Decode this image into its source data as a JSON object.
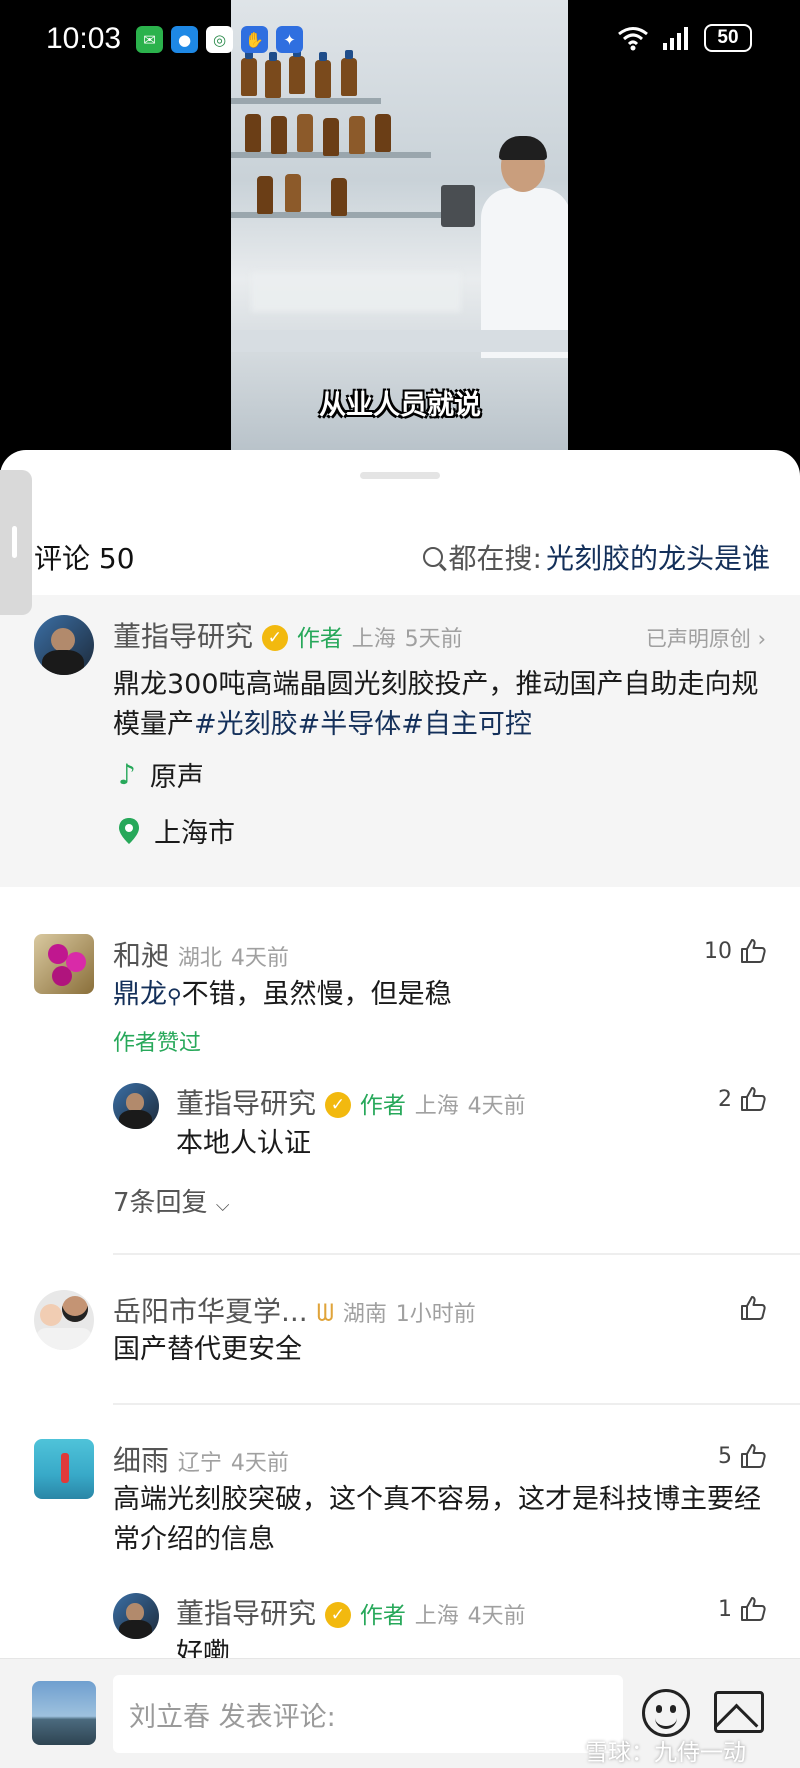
{
  "status_bar": {
    "time": "10:03",
    "battery": "50"
  },
  "video": {
    "subtitle": "从业人员就说"
  },
  "comments_header": {
    "count_label": "评论 50",
    "search_prefix": "都在搜:",
    "search_keyword": "光刻胶的龙头是谁"
  },
  "post": {
    "author": "董指导研究",
    "author_tag": "作者",
    "location": "上海",
    "time": "5天前",
    "original_label": "已声明原创",
    "text_plain": "鼎龙300吨高端晶圆光刻胶投产，推动国产自助走向规模量产",
    "hashtags": "#光刻胶#半导体#自主可控",
    "music_label": "原声",
    "place_label": "上海市"
  },
  "comments": [
    {
      "author": "和昶",
      "location": "湖北",
      "time": "4天前",
      "likes": "10",
      "text_link": "鼎龙",
      "text": "不错，虽然慢，但是稳",
      "liked_by_author": "作者赞过",
      "reply": {
        "author": "董指导研究",
        "author_tag": "作者",
        "location": "上海",
        "time": "4天前",
        "likes": "2",
        "text": "本地人认证"
      },
      "more_replies": "7条回复"
    },
    {
      "author": "岳阳市华夏学...",
      "location": "湖南",
      "time": "1小时前",
      "text": "国产替代更安全"
    },
    {
      "author": "细雨",
      "location": "辽宁",
      "time": "4天前",
      "likes": "5",
      "text": "高端光刻胶突破，这个真不容易，这才是科技博主要经常介绍的信息",
      "reply": {
        "author": "董指导研究",
        "author_tag": "作者",
        "location": "上海",
        "time": "4天前",
        "likes": "1",
        "text": "好嘞"
      }
    }
  ],
  "composer": {
    "placeholder": "刘立春 发表评论:"
  },
  "watermark": "雪球：九侍一动",
  "colors": {
    "accent_green": "#27a85a",
    "hashtag_navy": "#14305a",
    "verified_gold": "#f2b90f"
  }
}
